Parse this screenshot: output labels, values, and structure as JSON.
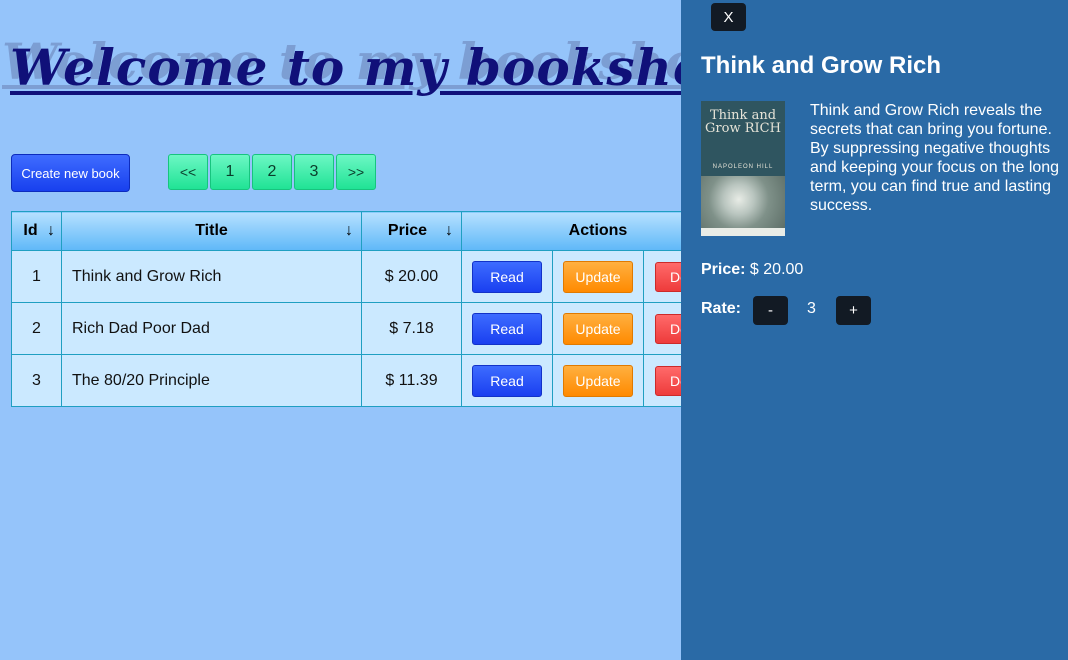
{
  "header": {
    "title": "Welcome to my bookshop"
  },
  "toolbar": {
    "create_label": "Create new book"
  },
  "pagination": {
    "first": "<<",
    "pages": [
      "1",
      "2",
      "3"
    ],
    "last": ">>"
  },
  "table": {
    "headers": {
      "id": "Id",
      "title": "Title",
      "price": "Price",
      "actions": "Actions"
    },
    "sort_arrow": "↓",
    "rows": [
      {
        "id": "1",
        "title": "Think and Grow Rich",
        "price": "$ 20.00"
      },
      {
        "id": "2",
        "title": "Rich Dad Poor Dad",
        "price": "$ 7.18"
      },
      {
        "id": "3",
        "title": "The 80/20 Principle",
        "price": "$ 11.39"
      }
    ],
    "read_label": "Read",
    "update_label": "Update",
    "delete_label": "De"
  },
  "panel": {
    "close_label": "X",
    "book_title": "Think and Grow Rich",
    "cover": {
      "title": "Think and Grow RICH",
      "author": "NAPOLEON HILL"
    },
    "description": "Think and Grow Rich reveals the secrets that can bring you fortune. By suppressing negative thoughts and keeping your focus on the long term, you can find true and lasting success.",
    "price_label": "Price:",
    "price_value": "$ 20.00",
    "rate_label": "Rate:",
    "rate_minus": "-",
    "rate_value": "3",
    "rate_plus": "+"
  },
  "colors": {
    "background": "#95c4fa",
    "panel": "#2a6aa6",
    "title": "#101079",
    "read_button": "#1a3ff0",
    "update_button": "#ff8a00",
    "delete_button": "#ee3b3b",
    "pagination": "#20e395"
  }
}
